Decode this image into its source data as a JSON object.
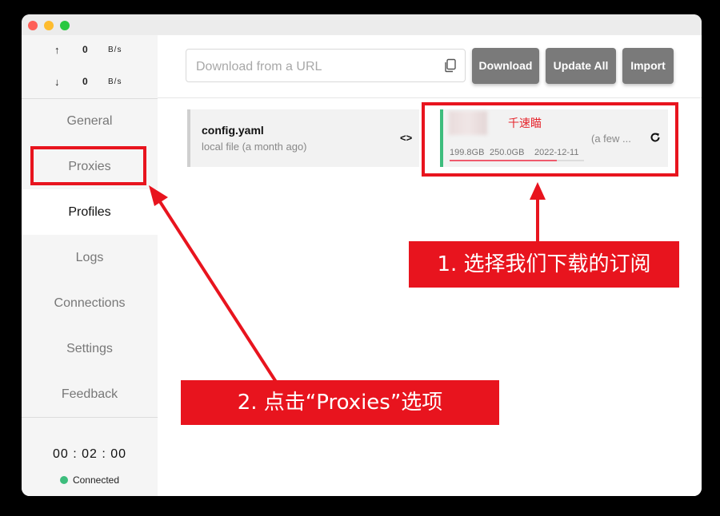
{
  "window": {
    "title": ""
  },
  "traffic": {
    "upload": {
      "arrow": "↑",
      "value": "0",
      "unit": "B/s"
    },
    "download": {
      "arrow": "↓",
      "value": "0",
      "unit": "B/s"
    }
  },
  "sidebar": {
    "items": [
      {
        "label": "General",
        "active": false
      },
      {
        "label": "Proxies",
        "active": false
      },
      {
        "label": "Profiles",
        "active": true
      },
      {
        "label": "Logs",
        "active": false
      },
      {
        "label": "Connections",
        "active": false
      },
      {
        "label": "Settings",
        "active": false
      },
      {
        "label": "Feedback",
        "active": false
      }
    ],
    "timer": "00 : 02 : 00",
    "status": "Connected",
    "status_color": "#3dbd7d"
  },
  "toolbar": {
    "url_placeholder": "Download from a URL",
    "download_label": "Download",
    "update_all_label": "Update All",
    "import_label": "Import",
    "copy_icon": "copy-icon"
  },
  "profiles": [
    {
      "name": "config.yaml",
      "subtitle": "local file (a month ago)",
      "icon": "code-icon"
    }
  ],
  "subscription": {
    "name": "千速瞄",
    "updated": "(a few ...",
    "used": "199.8GB",
    "total": "250.0GB",
    "expires": "2022-12-11",
    "usage_fraction": 0.8,
    "accent": "#3dbd7d",
    "icon": "refresh-icon"
  },
  "annotations": {
    "step1": "1. 选择我们下载的订阅",
    "step2": "2. 点击“Proxies”选项",
    "color": "#e8141e"
  }
}
